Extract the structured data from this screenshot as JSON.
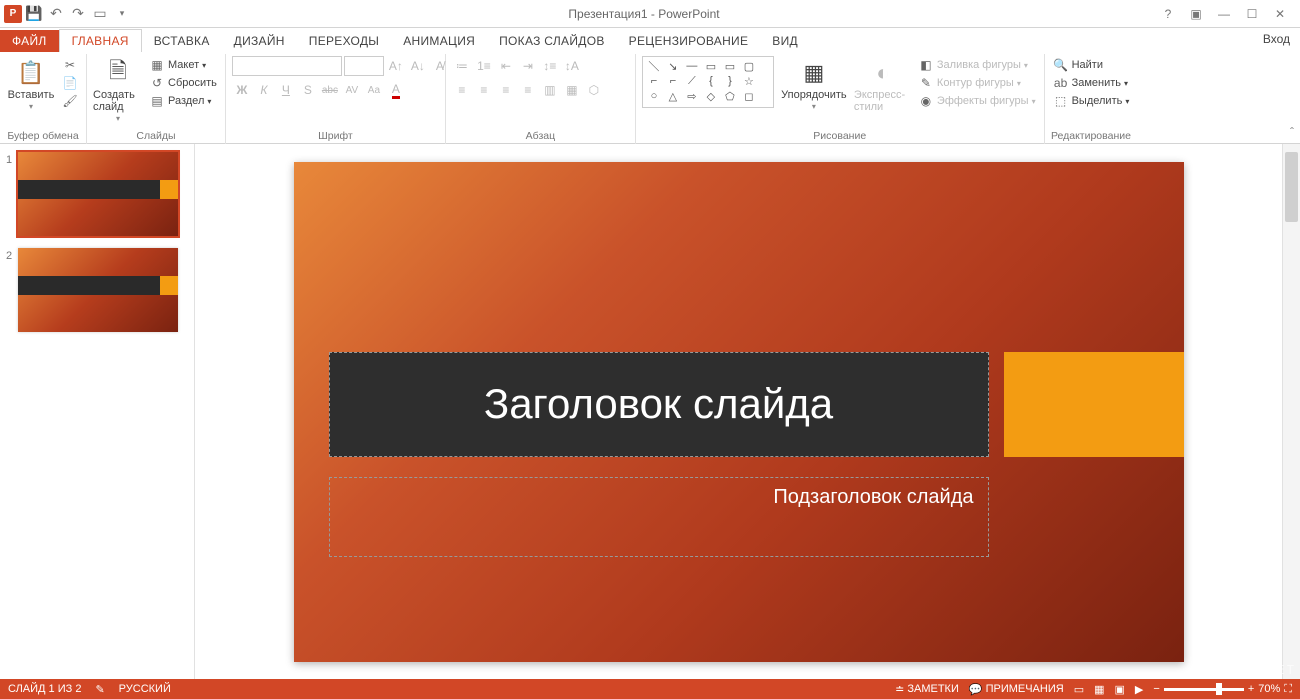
{
  "titlebar": {
    "title": "Презентация1 - PowerPoint"
  },
  "tabs": {
    "file": "ФАЙЛ",
    "items": [
      "ГЛАВНАЯ",
      "ВСТАВКА",
      "ДИЗАЙН",
      "ПЕРЕХОДЫ",
      "АНИМАЦИЯ",
      "ПОКАЗ СЛАЙДОВ",
      "РЕЦЕНЗИРОВАНИЕ",
      "ВИД"
    ],
    "signin": "Вход"
  },
  "ribbon": {
    "clipboard": {
      "paste": "Вставить",
      "label": "Буфер обмена"
    },
    "slides": {
      "new": "Создать слайд",
      "layout": "Макет",
      "reset": "Сбросить",
      "section": "Раздел",
      "label": "Слайды"
    },
    "font": {
      "label": "Шрифт",
      "b": "Ж",
      "i": "К",
      "u": "Ч",
      "s": "S",
      "strike": "abc",
      "av": "AV",
      "aa": "Aa"
    },
    "para": {
      "label": "Абзац"
    },
    "draw": {
      "arrange": "Упорядочить",
      "styles": "Экспресс-стили",
      "fill": "Заливка фигуры",
      "outline": "Контур фигуры",
      "effects": "Эффекты фигуры",
      "label": "Рисование"
    },
    "edit": {
      "find": "Найти",
      "replace": "Заменить",
      "select": "Выделить",
      "label": "Редактирование"
    }
  },
  "thumbnails": [
    {
      "num": "1"
    },
    {
      "num": "2"
    }
  ],
  "slide": {
    "title": "Заголовок слайда",
    "subtitle": "Подзаголовок слайда"
  },
  "status": {
    "slide": "СЛАЙД 1 ИЗ 2",
    "lang": "РУССКИЙ",
    "notes": "ЗАМЕТКИ",
    "comments": "ПРИМЕЧАНИЯ",
    "zoom": "70%"
  },
  "watermark": "PCPROGS.NET"
}
